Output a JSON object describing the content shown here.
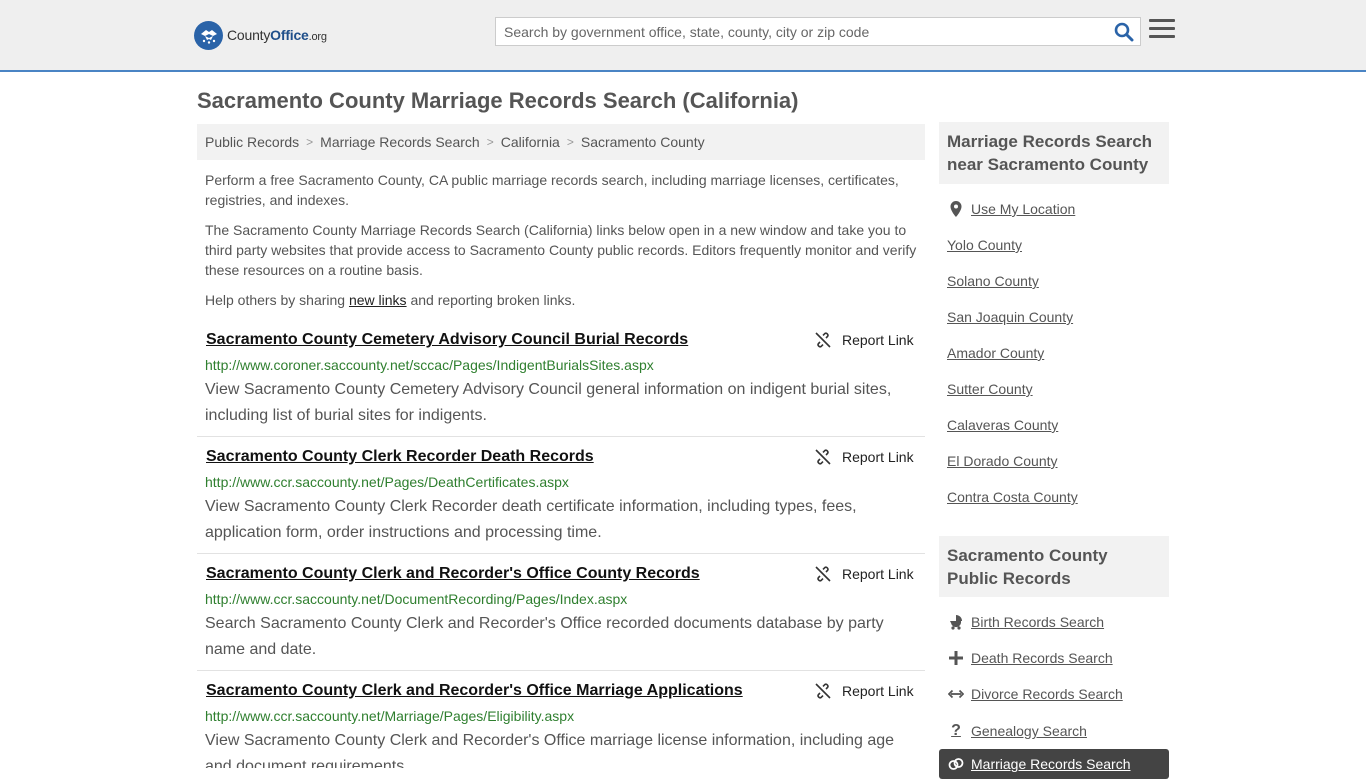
{
  "header": {
    "logo": {
      "brand_a": "County",
      "brand_b": "Office",
      "tld": ".org"
    },
    "search": {
      "placeholder": "Search by government office, state, county, city or zip code",
      "value": ""
    },
    "icons": {
      "search": "search-icon",
      "menu": "hamburger-menu-icon"
    }
  },
  "page": {
    "title": "Sacramento County Marriage Records Search (California)",
    "breadcrumb": [
      "Public Records",
      "Marriage Records Search",
      "California",
      "Sacramento County"
    ],
    "intro": [
      "Perform a free Sacramento County, CA public marriage records search, including marriage licenses, certificates, registries, and indexes.",
      "The Sacramento County Marriage Records Search (California) links below open in a new window and take you to third party websites that provide access to Sacramento County public records. Editors frequently monitor and verify these resources on a routine basis."
    ],
    "share": {
      "before": "Help others by sharing ",
      "link": "new links",
      "after": " and reporting broken links."
    }
  },
  "listings": [
    {
      "title": "Sacramento County Cemetery Advisory Council Burial Records",
      "url": "http://www.coroner.saccounty.net/sccac/Pages/IndigentBurialsSites.aspx",
      "description": "View Sacramento County Cemetery Advisory Council general information on indigent burial sites, including list of burial sites for indigents.",
      "report_label": "Report Link"
    },
    {
      "title": "Sacramento County Clerk Recorder Death Records",
      "url": "http://www.ccr.saccounty.net/Pages/DeathCertificates.aspx",
      "description": "View Sacramento County Clerk Recorder death certificate information, including types, fees, application form, order instructions and processing time.",
      "report_label": "Report Link"
    },
    {
      "title": "Sacramento County Clerk and Recorder's Office County Records",
      "url": "http://www.ccr.saccounty.net/DocumentRecording/Pages/Index.aspx",
      "description": "Search Sacramento County Clerk and Recorder's Office recorded documents database by party name and date.",
      "report_label": "Report Link"
    },
    {
      "title": "Sacramento County Clerk and Recorder's Office Marriage Applications",
      "url": "http://www.ccr.saccounty.net/Marriage/Pages/Eligibility.aspx",
      "description": "View Sacramento County Clerk and Recorder's Office marriage license information, including age and document requirements.",
      "report_label": "Report Link"
    }
  ],
  "sidebar": {
    "nearby": {
      "heading": "Marriage Records Search near Sacramento County",
      "use_location": "Use My Location",
      "counties": [
        "Yolo County",
        "Solano County",
        "San Joaquin County",
        "Amador County",
        "Sutter County",
        "Calaveras County",
        "El Dorado County",
        "Contra Costa County"
      ]
    },
    "public_records": {
      "heading": "Sacramento County Public Records",
      "items": [
        {
          "label": "Birth Records Search",
          "icon": "baby-carriage-icon"
        },
        {
          "label": "Death Records Search",
          "icon": "cross-icon"
        },
        {
          "label": "Divorce Records Search",
          "icon": "arrows-split-icon"
        },
        {
          "label": "Genealogy Search",
          "icon": "question-mark-icon"
        }
      ],
      "active": {
        "label": "Marriage Records Search",
        "icon": "rings-icon"
      }
    }
  }
}
